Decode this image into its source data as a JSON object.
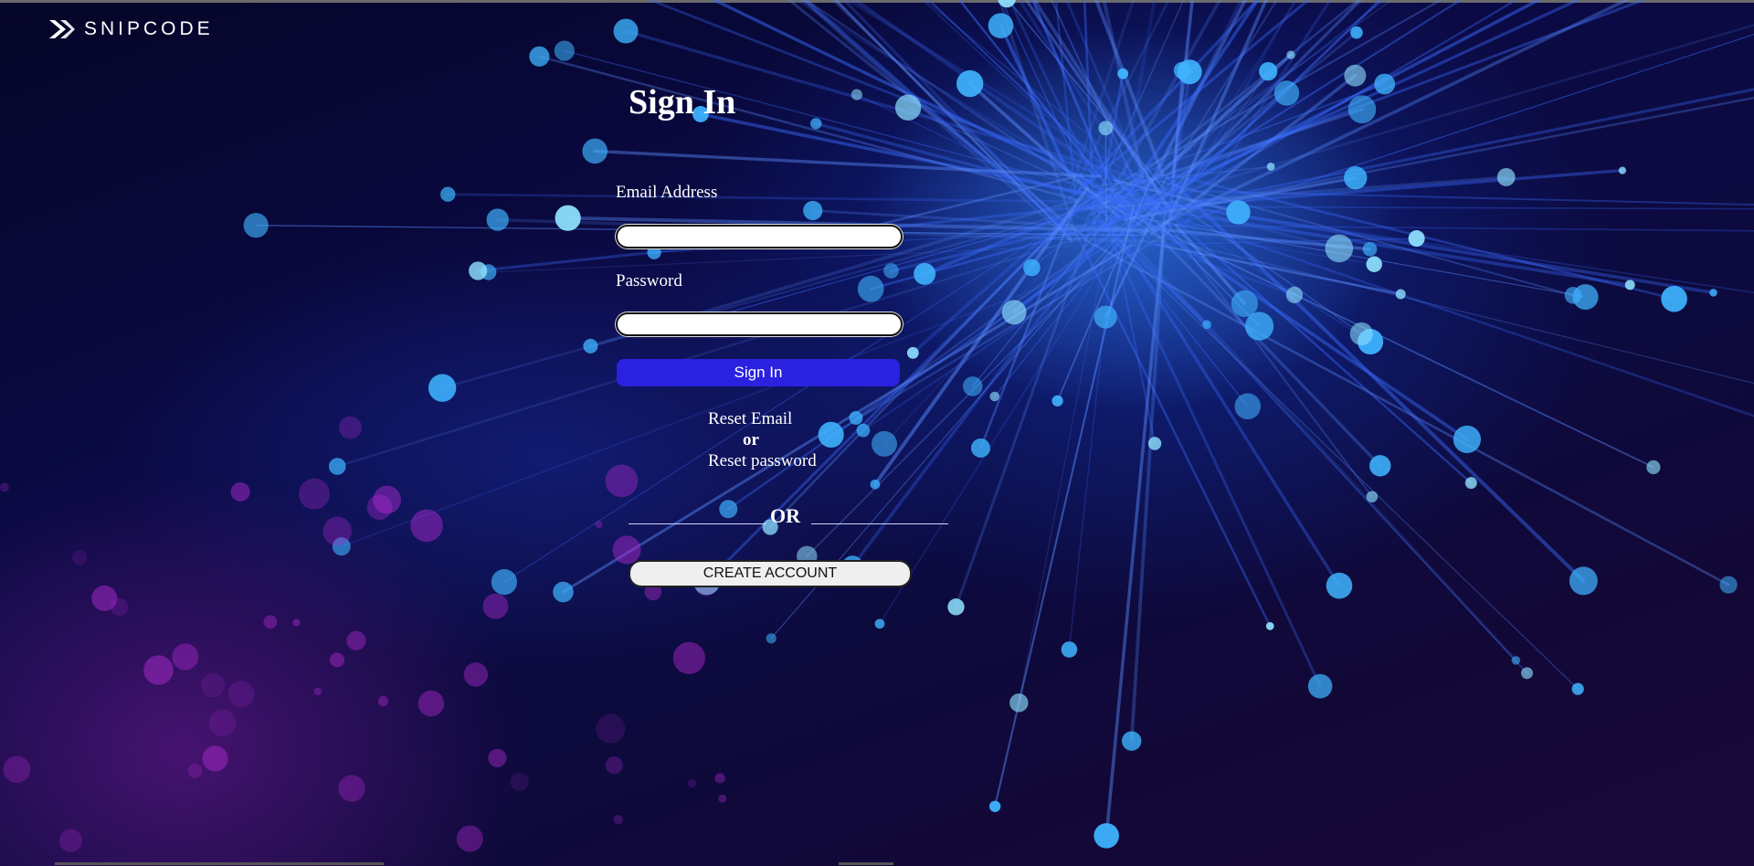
{
  "brand": {
    "name": "SNIPCODE",
    "logo_icon": "snipcode-logo-icon"
  },
  "form": {
    "title": "Sign In",
    "email_label": "Email Address",
    "email_value": "",
    "password_label": "Password",
    "password_value": "",
    "signin_button": "Sign In",
    "reset_email_link": "Reset Email",
    "reset_or": "or",
    "reset_password_link": "Reset password",
    "separator": "OR",
    "create_account_button": "CREATE ACCOUNT"
  },
  "colors": {
    "primary_button": "#2a22e0",
    "background_dark": "#0b0a45",
    "glow_blue": "#3c96ff"
  }
}
